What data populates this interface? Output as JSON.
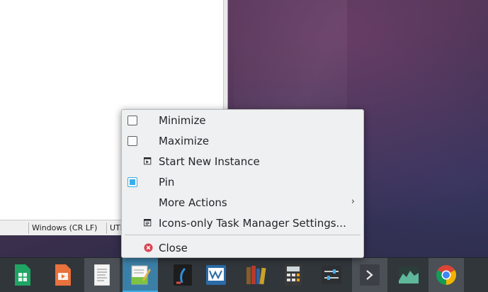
{
  "editor": {
    "statusbar": {
      "line_ending": "Windows (CR LF)",
      "encoding": "UTF"
    }
  },
  "context_menu": {
    "items": [
      {
        "label": "Minimize",
        "icon": "checkbox-unchecked-icon",
        "checked": false
      },
      {
        "label": "Maximize",
        "icon": "checkbox-unchecked-icon",
        "checked": false
      },
      {
        "label": "Start New Instance",
        "icon": "new-instance-icon"
      },
      {
        "label": "Pin",
        "icon": "checkbox-checked-icon",
        "checked": true
      },
      {
        "label": "More Actions",
        "icon": "",
        "has_submenu": true,
        "submenu_arrow": "›"
      },
      {
        "label": "Icons-only Task Manager Settings...",
        "icon": "settings-icon"
      },
      {
        "label": "Close",
        "icon": "close-icon"
      }
    ]
  },
  "taskbar": {
    "apps": [
      {
        "name": "spreadsheet-app-icon",
        "color": "#1fa463"
      },
      {
        "name": "presentation-app-icon",
        "color": "#e8713c"
      },
      {
        "name": "text-document-app-icon",
        "color": "#f2f2f2",
        "state": "active"
      },
      {
        "name": "text-editor-app-icon",
        "color": "#7dc242",
        "state": "current"
      },
      {
        "name": "dark-app-icon",
        "color": "#1d1d1d"
      },
      {
        "name": "monitor-app-icon",
        "color": "#2b6aa6"
      },
      {
        "name": "ebook-library-app-icon",
        "color": "#8a5a2b"
      },
      {
        "name": "calculator-app-icon",
        "color": "#3a3a3a"
      },
      {
        "name": "settings-sliders-app-icon",
        "color": "#2d2f33"
      },
      {
        "name": "terminal-app-icon",
        "color": "#3c4046",
        "state": "active"
      },
      {
        "name": "system-monitor-app-icon",
        "color": "#3d7d6b"
      },
      {
        "name": "chrome-browser-icon",
        "color": "#db4437"
      }
    ]
  },
  "colors": {
    "accent": "#3daee9",
    "menu_background": "#eff0f1",
    "taskbar_background": "#31363b",
    "close_red": "#da4453"
  }
}
